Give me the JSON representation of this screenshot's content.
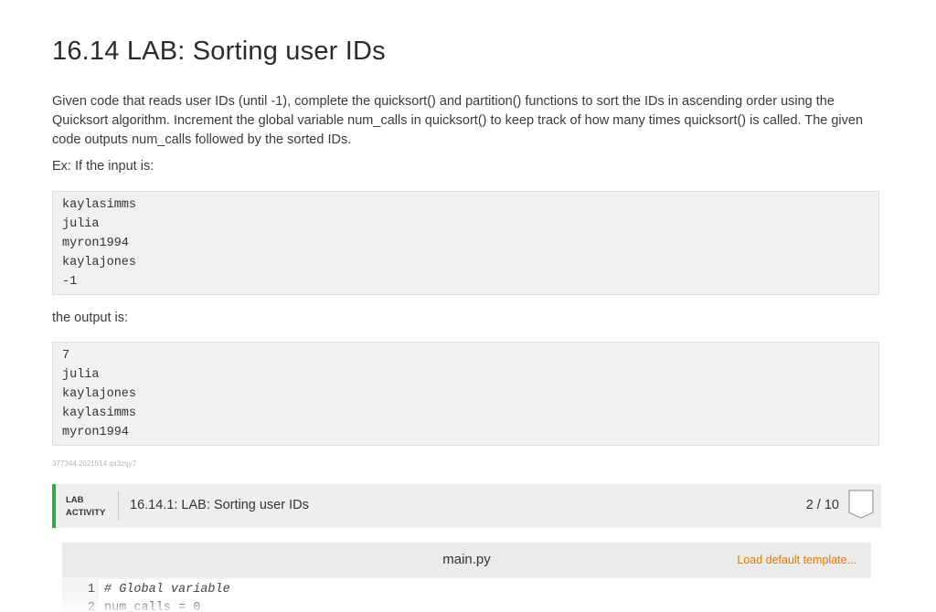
{
  "title": "16.14 LAB: Sorting user IDs",
  "description": "Given code that reads user IDs (until -1), complete the quicksort() and partition() functions to sort the IDs in ascending order using the Quicksort algorithm. Increment the global variable num_calls in quicksort() to keep track of how many times quicksort() is called. The given code outputs num_calls followed by the sorted IDs.",
  "example_intro": "Ex: If the input is:",
  "input_lines": [
    "kaylasimms",
    "julia",
    "myron1994",
    "kaylajones",
    "-1"
  ],
  "output_intro": "the output is:",
  "output_lines": [
    "7",
    "julia",
    "kaylajones",
    "kaylasimms",
    "myron1994"
  ],
  "tracking_id": "377344.2021514.qx3zqy7",
  "lab": {
    "tag_line1": "LAB",
    "tag_line2": "ACTIVITY",
    "title": "16.14.1: LAB: Sorting user IDs",
    "score": "2 / 10",
    "score_fraction": 0.2
  },
  "editor": {
    "filename": "main.py",
    "load_template": "Load default template...",
    "lines": [
      {
        "num": "1",
        "code": "# Global variable"
      },
      {
        "num": "2",
        "code": "num_calls = 0"
      }
    ]
  },
  "colors": {
    "accent_green": "#37a34a",
    "link_orange": "#e07b00"
  }
}
